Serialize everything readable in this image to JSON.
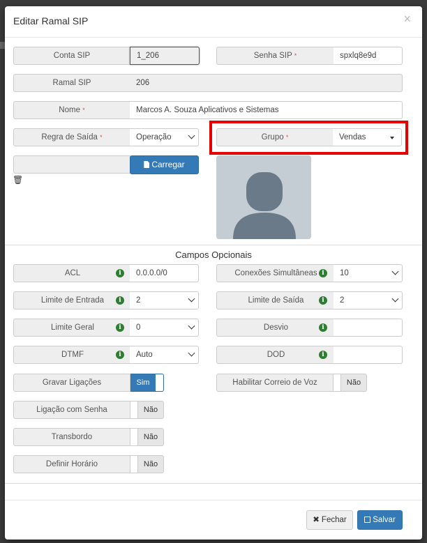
{
  "modal": {
    "title": "Editar Ramal SIP",
    "close_glyph": "×"
  },
  "fields": {
    "conta_sip": {
      "label": "Conta SIP",
      "value": "1_206"
    },
    "senha_sip": {
      "label": "Senha SIP",
      "value": "spxlq8e9d"
    },
    "ramal_sip": {
      "label": "Ramal SIP",
      "value": "206"
    },
    "nome": {
      "label": "Nome",
      "value": "Marcos A. Souza Aplicativos e Sistemas"
    },
    "regra_saida": {
      "label": "Regra de Saída",
      "value": "Operação"
    },
    "grupo": {
      "label": "Grupo",
      "value": "Vendas"
    },
    "required_mark": "*"
  },
  "upload": {
    "button_label": "Carregar",
    "trash_glyph": "🗑"
  },
  "optional": {
    "title": "Campos Opcionais",
    "acl": {
      "label": "ACL",
      "value": "0.0.0.0/0"
    },
    "conexoes": {
      "label": "Conexões Simultâneas",
      "value": "10"
    },
    "limite_entrada": {
      "label": "Limite de Entrada",
      "value": "2"
    },
    "limite_saida": {
      "label": "Limite de Saída",
      "value": "2"
    },
    "limite_geral": {
      "label": "Limite Geral",
      "value": "0"
    },
    "desvio": {
      "label": "Desvio",
      "value": ""
    },
    "dtmf": {
      "label": "DTMF",
      "value": "Auto"
    },
    "dod": {
      "label": "DOD",
      "value": ""
    },
    "gravar": {
      "label": "Gravar Ligações",
      "value": "Sim"
    },
    "correio_voz": {
      "label": "Habilitar Correio de Voz",
      "value": "Não"
    },
    "ligacao_senha": {
      "label": "Ligação com Senha",
      "value": "Não"
    },
    "transbordo": {
      "label": "Transbordo",
      "value": "Não"
    },
    "definir_horario": {
      "label": "Definir Horário",
      "value": "Não"
    },
    "info_glyph": "i"
  },
  "footer": {
    "close_label": "Fechar",
    "save_label": "Salvar"
  },
  "colors": {
    "primary": "#337ab7",
    "info_icon": "#2e7d32",
    "required": "#d9534f",
    "highlight": "#e60000"
  }
}
